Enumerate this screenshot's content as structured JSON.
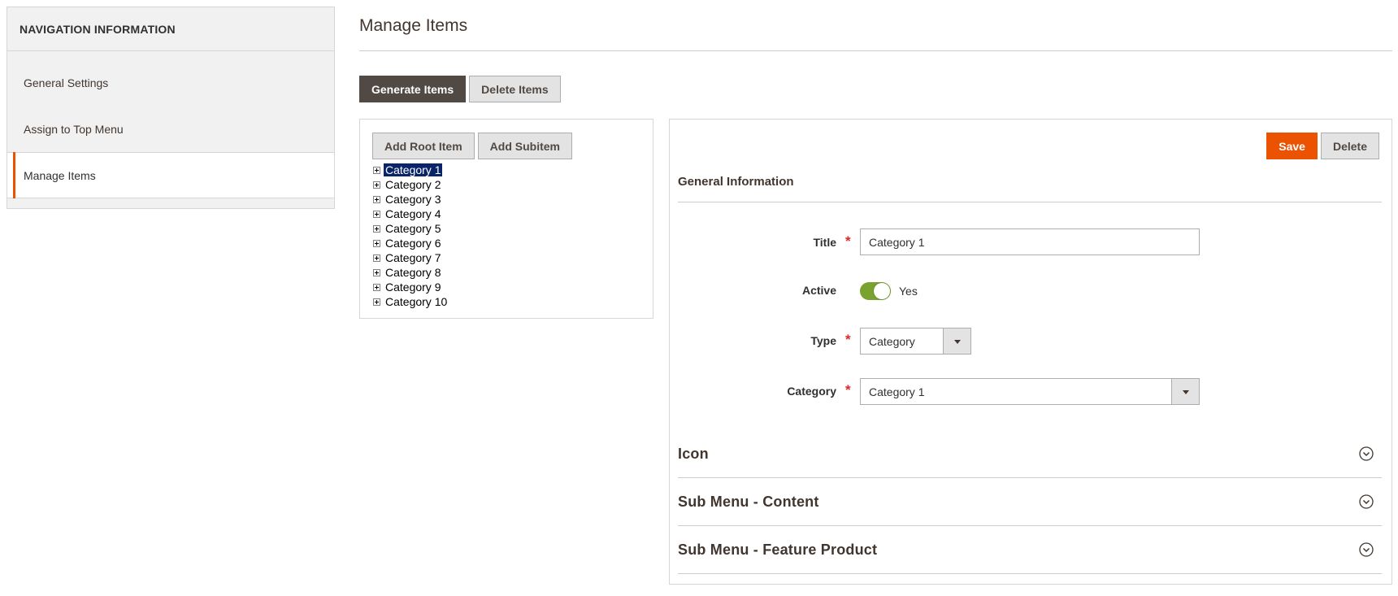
{
  "sidebar": {
    "title": "NAVIGATION INFORMATION",
    "items": [
      {
        "label": "General Settings"
      },
      {
        "label": "Assign to Top Menu"
      },
      {
        "label": "Manage Items"
      }
    ]
  },
  "page": {
    "title": "Manage Items",
    "generate_label": "Generate Items",
    "delete_items_label": "Delete Items"
  },
  "tree": {
    "add_root_label": "Add Root Item",
    "add_subitem_label": "Add Subitem",
    "nodes": [
      "Category 1",
      "Category 2",
      "Category 3",
      "Category 4",
      "Category 5",
      "Category 6",
      "Category 7",
      "Category 8",
      "Category 9",
      "Category 10"
    ],
    "selected": "Category 1"
  },
  "form": {
    "save_label": "Save",
    "delete_label": "Delete",
    "section_title": "General Information",
    "title_label": "Title",
    "title_value": "Category 1",
    "active_label": "Active",
    "active_value": "Yes",
    "type_label": "Type",
    "type_value": "Category",
    "category_label": "Category",
    "category_value": "Category 1",
    "required_mark": "*"
  },
  "collapsibles": [
    {
      "title": "Icon"
    },
    {
      "title": "Sub Menu - Content"
    },
    {
      "title": "Sub Menu - Feature Product"
    }
  ],
  "colors": {
    "accent": "#eb5202",
    "dark_button": "#514943",
    "toggle_on": "#79a22e",
    "selection": "#0a246a"
  },
  "icons": {
    "tree_toggle": "plus-box-icon",
    "collapse": "chevron-down-circle-icon",
    "select_arrow": "caret-down-icon"
  }
}
